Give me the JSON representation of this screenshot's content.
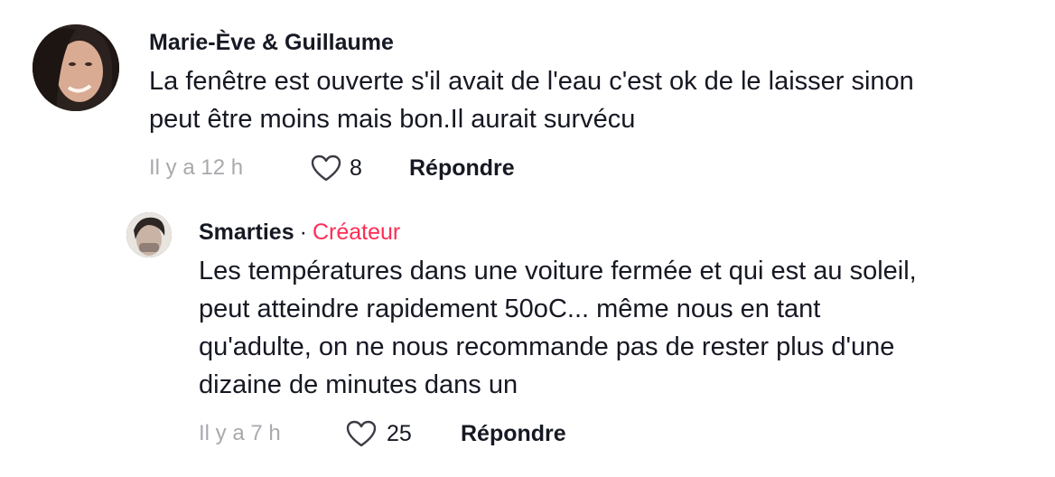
{
  "comments": [
    {
      "author": "Marie-Ève & Guillaume",
      "text_line1": "La fenêtre est ouverte s'il avait de l'eau c'est ok de le laisser sinon",
      "text_line2": "peut être moins mais bon.Il aurait survécu",
      "time": "Il y a 12 h",
      "likes": "8",
      "reply_label": "Répondre",
      "avatar_icon": "profile-photo"
    }
  ],
  "reply": {
    "author": "Smarties",
    "separator": "·",
    "badge": "Créateur",
    "badge_color": "#fe2c55",
    "text_line1": "Les températures dans une voiture fermée et qui est au soleil,",
    "text_line2": "peut atteindre rapidement 50oC... même nous en tant",
    "text_line3": "qu'adulte, on ne nous recommande pas de rester plus d'une",
    "text_line4": "dizaine de minutes dans un",
    "time": "Il y a 7 h",
    "likes": "25",
    "reply_label": "Répondre",
    "avatar_icon": "profile-photo"
  },
  "icons": {
    "like": "heart-outline-icon"
  }
}
